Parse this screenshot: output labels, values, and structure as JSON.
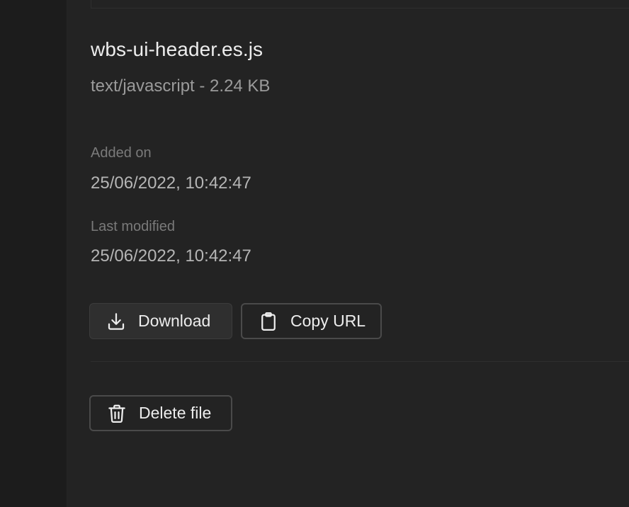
{
  "file": {
    "name": "wbs-ui-header.es.js",
    "meta": "text/javascript - 2.24 KB"
  },
  "details": {
    "added_label": "Added on",
    "added_value": "25/06/2022, 10:42:47",
    "modified_label": "Last modified",
    "modified_value": "25/06/2022, 10:42:47"
  },
  "actions": {
    "download_label": "Download",
    "download_icon": "download-icon",
    "copy_label": "Copy URL",
    "copy_icon": "clipboard-icon",
    "delete_label": "Delete file",
    "delete_icon": "trash-icon"
  }
}
